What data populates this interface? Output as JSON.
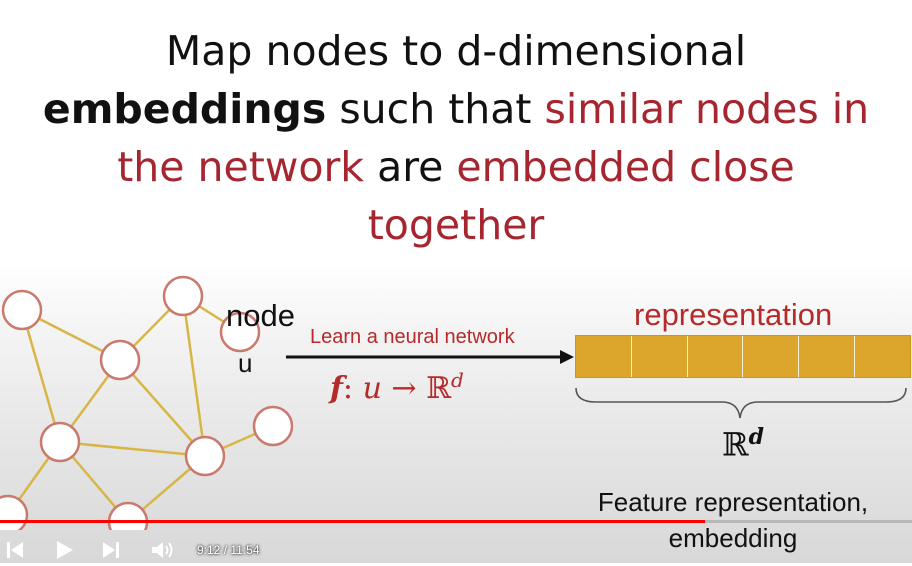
{
  "slide": {
    "title": {
      "line1": "Map nodes to d-dimensional",
      "line2_bold": "embeddings",
      "line2_plain": " such that ",
      "line2_hl": "similar nodes in",
      "line3_hl": "the network",
      "line3_plain": " are ",
      "line3_hl2": "embedded close",
      "line4_hl": "together"
    },
    "node_label": "node",
    "u_label": "u",
    "learn_label": "Learn a neural network",
    "func": {
      "f": "f",
      "colon": ":",
      "u": "u",
      "arrow": " → ",
      "R": "ℝ",
      "sup": "d"
    },
    "representation_label": "representation",
    "rd": {
      "R": "ℝ",
      "sup": "d"
    },
    "feature_label": "Feature representation, embedding",
    "vector_cells": 6,
    "colors": {
      "highlight": "#a62630",
      "vector": "#dca62c",
      "graph_edge": "#d8b646",
      "graph_node": "#c97a6c"
    }
  },
  "player": {
    "current_time": "9:12",
    "separator": " / ",
    "duration": "11:54",
    "progress": 0.7731,
    "colors": {
      "progress": "#ff0000"
    },
    "icons": {
      "prev": "skip-previous-icon",
      "play": "play-icon",
      "next": "skip-next-icon",
      "volume": "volume-icon"
    }
  }
}
